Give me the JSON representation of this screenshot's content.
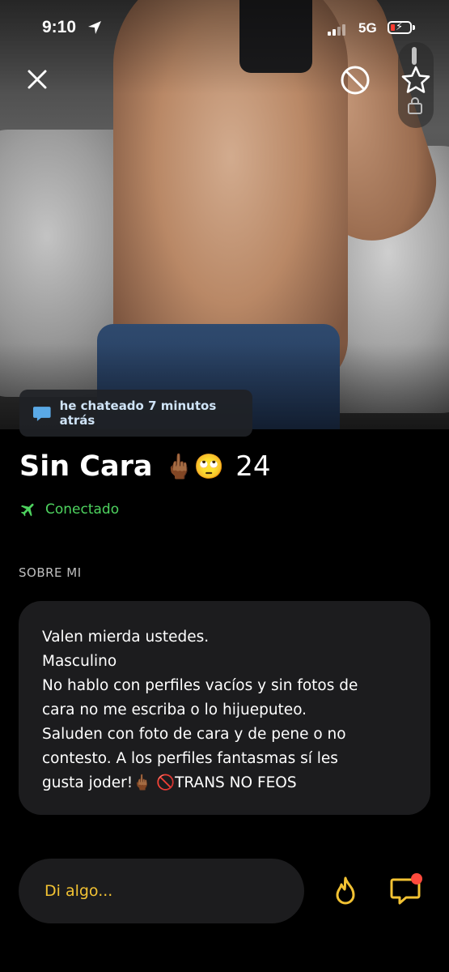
{
  "status_bar": {
    "time": "9:10",
    "network": "5G",
    "location_icon": "location-arrow-icon",
    "battery_state": "low-charging"
  },
  "top_controls": {
    "close_icon": "close-icon",
    "block_icon": "block-icon",
    "favorite_icon": "star-icon"
  },
  "chat_badge": {
    "icon": "chat-bubble-icon",
    "text": "he chateado 7 minutos atrás"
  },
  "profile": {
    "name": "Sin Cara",
    "emojis": "🖕🏾🙄",
    "age": "24",
    "status_icon": "airplane-icon",
    "status": "Conectado"
  },
  "about": {
    "label": "SOBRE MI",
    "lines": [
      "Valen mierda ustedes.",
      "Masculino",
      "No hablo con perfiles vacíos y sin fotos de",
      "cara no me escriba o lo hijueputeo.",
      "Saluden con foto de cara y de pene o no",
      "contesto. A los perfiles fantasmas sí les",
      "gusta joder!🖕🏾 🚫TRANS NO FEOS"
    ]
  },
  "bottom_bar": {
    "input_placeholder": "Di algo...",
    "tap_icon": "flame-icon",
    "message_icon": "message-bubble-icon"
  },
  "colors": {
    "background": "#000000",
    "card": "#1c1c1e",
    "online_green": "#4ed35f",
    "accent_yellow": "#f2c233",
    "badge_text": "#cfe3f6",
    "notification_red": "#ff4a3d"
  }
}
